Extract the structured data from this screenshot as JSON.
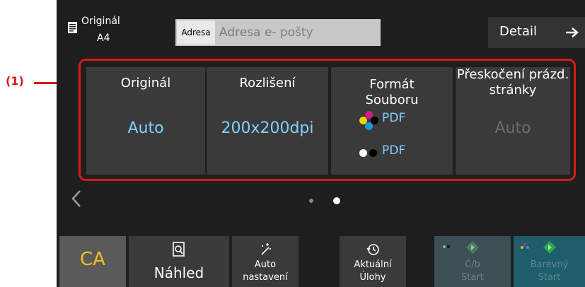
{
  "header": {
    "original_label": "Originál",
    "original_size": "A4",
    "address_button": "Adresa",
    "address_placeholder": "Adresa e- pošty",
    "detail_label": "Detail"
  },
  "callout_label": "(1)",
  "tiles": [
    {
      "title": "Originál",
      "value": "Auto"
    },
    {
      "title": "Rozlišení",
      "value": "200x200dpi"
    },
    {
      "title": "Formát Souboru",
      "color_format": "PDF",
      "bw_format": "PDF"
    },
    {
      "title": "Přeskočení prázd. stránky",
      "value": "Auto"
    }
  ],
  "pagination": {
    "pages": 2,
    "current": 2
  },
  "buttons": {
    "ca": "CA",
    "preview": "Náhled",
    "auto_line1": "Auto",
    "auto_line2": "nastavení",
    "recent_line1": "Aktuální",
    "recent_line2": "Úlohy",
    "bw_line1": "Č/b",
    "bw_line2": "Start",
    "color_line1": "Barevný",
    "color_line2": "Start"
  },
  "colors": {
    "accent_value": "#7fd0ff",
    "callout": "#d61a1a",
    "ca_text": "#f4c020",
    "start_green": "#2aa84a"
  },
  "icons": {
    "original": "document-icon",
    "detail_arrow": "arrow-right-icon",
    "prev_page": "chevron-left-icon",
    "preview": "magnifier-page-icon",
    "auto": "magic-wand-icon",
    "recent": "history-icon",
    "start": "diamond-start-icon"
  }
}
